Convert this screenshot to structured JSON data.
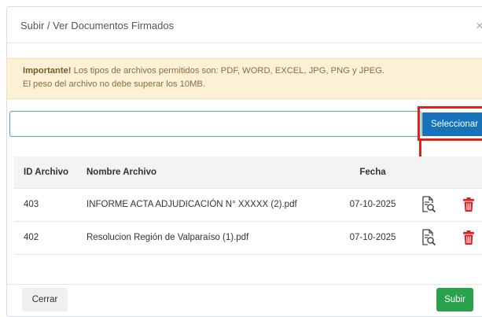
{
  "modal": {
    "title": "Subir / Ver Documentos Firmados",
    "close_icon": "×"
  },
  "alert": {
    "strong": "Importante!",
    "line1": " Los tipos de archivos permitidos son: PDF, WORD, EXCEL, JPG, PNG y JPEG.",
    "line2": "El peso del archivo no debe superar los 10MB."
  },
  "upload": {
    "value": "",
    "select_label": "Seleccionar"
  },
  "table": {
    "headers": [
      "ID Archivo",
      "Nombre Archivo",
      "Fecha"
    ],
    "rows": [
      {
        "id": "403",
        "name": "INFORME ACTA ADJUDICACIÓN N° XXXXX (2).pdf",
        "date": "07-10-2025"
      },
      {
        "id": "402",
        "name": "Resolucion Región de Valparaíso (1).pdf",
        "date": "07-10-2025"
      }
    ]
  },
  "icons": {
    "view": "view-document-icon",
    "delete": "trash-icon"
  },
  "colors": {
    "primary": "#1572bb",
    "success": "#2aa14b",
    "danger": "#e0201e",
    "warning_bg": "#fcf1d6",
    "warning_text": "#8a6d3b"
  },
  "footer": {
    "close_label": "Cerrar",
    "upload_label": "Subir"
  }
}
